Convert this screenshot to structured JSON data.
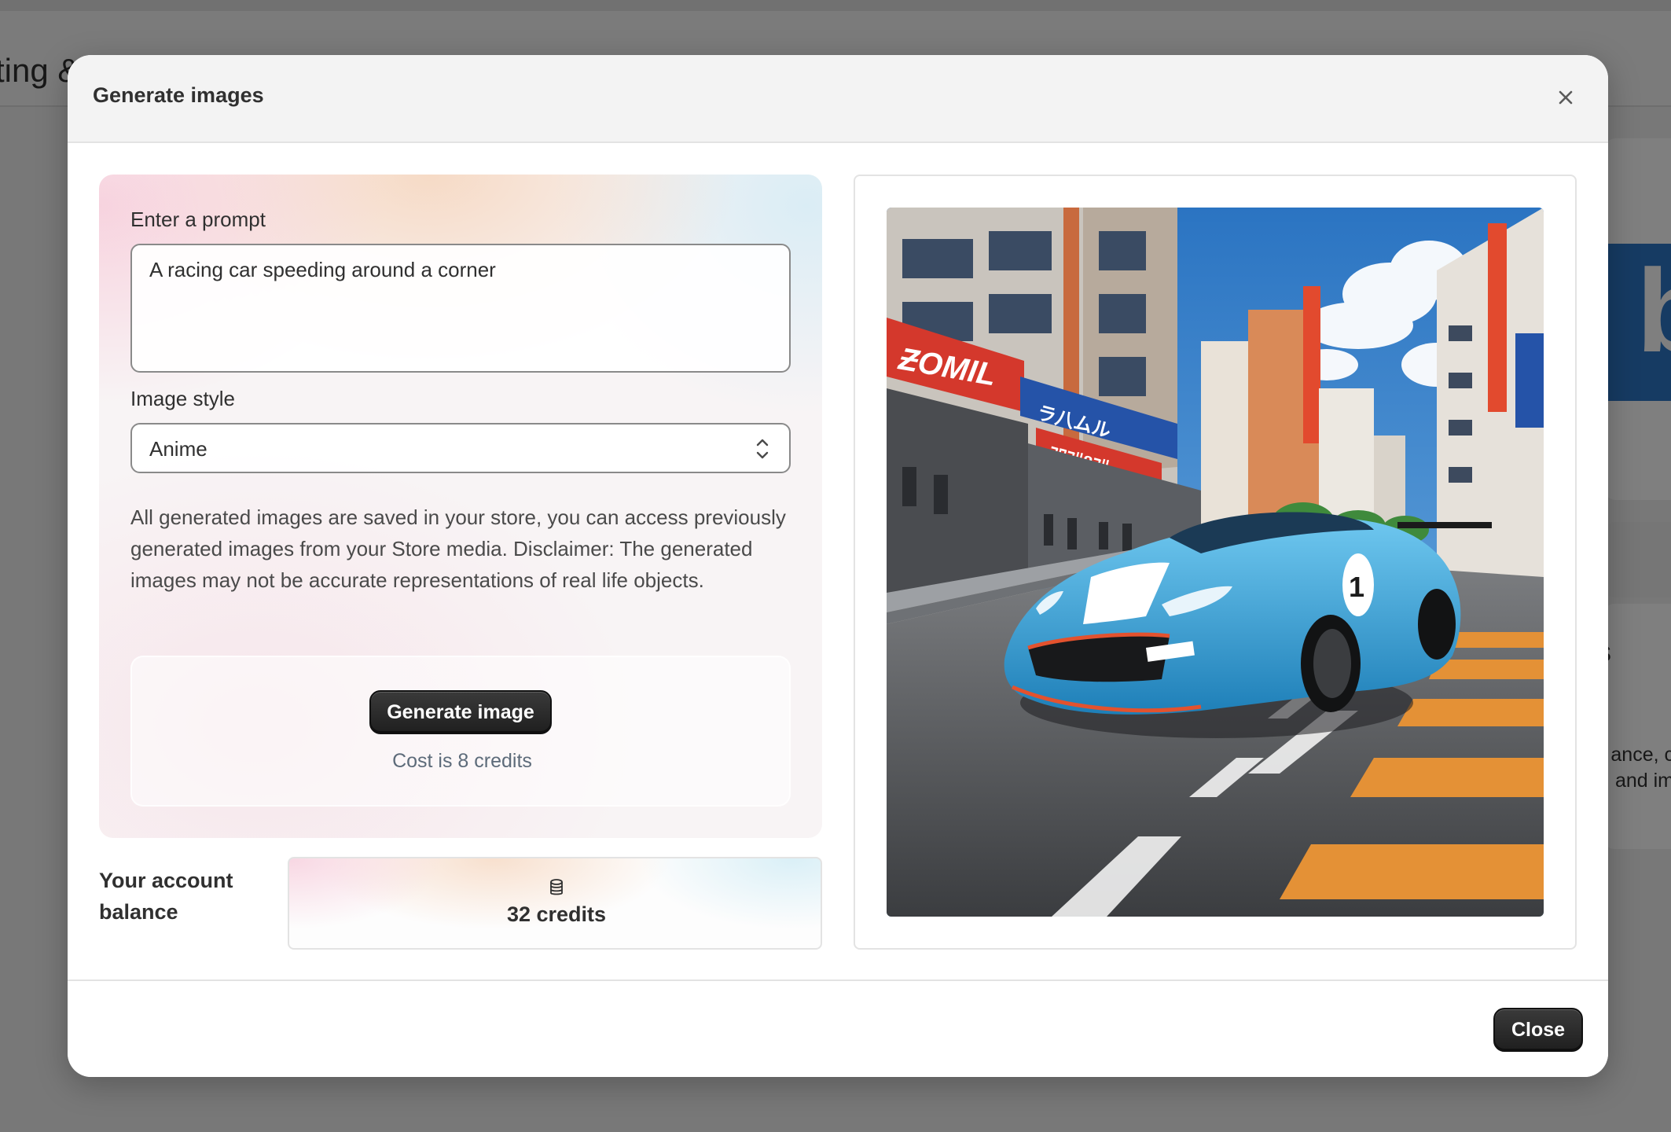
{
  "background": {
    "page_title": "ting & Creation Tools",
    "side_letter": "s",
    "side_text_1": "ance, c",
    "side_text_2": "and im"
  },
  "modal": {
    "title": "Generate images",
    "close_icon": "close-icon",
    "prompt": {
      "label": "Enter a prompt",
      "value": "A racing car speeding around a corner"
    },
    "image_style": {
      "label": "Image style",
      "selected": "Anime",
      "icon": "chevron-up-down-icon"
    },
    "disclaimer": "All generated images are saved in your store, you can access previously generated images from your Store media. Disclaimer: The generated images may not be accurate representations of real life objects.",
    "generate_button_label": "Generate image",
    "cost_text": "Cost is 8 credits",
    "balance": {
      "label": "Your account balance",
      "icon": "database-coins-icon",
      "value": "32 credits"
    },
    "image": {
      "alt": "generated-image",
      "sign_1": "ƵOMIL",
      "sign_2": "ラ八ムル",
      "sign_3": "ﾌﾜﾌﾘ8ﾌﾘ"
    },
    "close_button_label": "Close"
  },
  "colors": {
    "overlay": "#7a7a7a",
    "primary_button": "#1f1f1f",
    "cost_text": "#5d6b7a",
    "sky": "#2f7fc9",
    "car": "#39a7dd"
  }
}
